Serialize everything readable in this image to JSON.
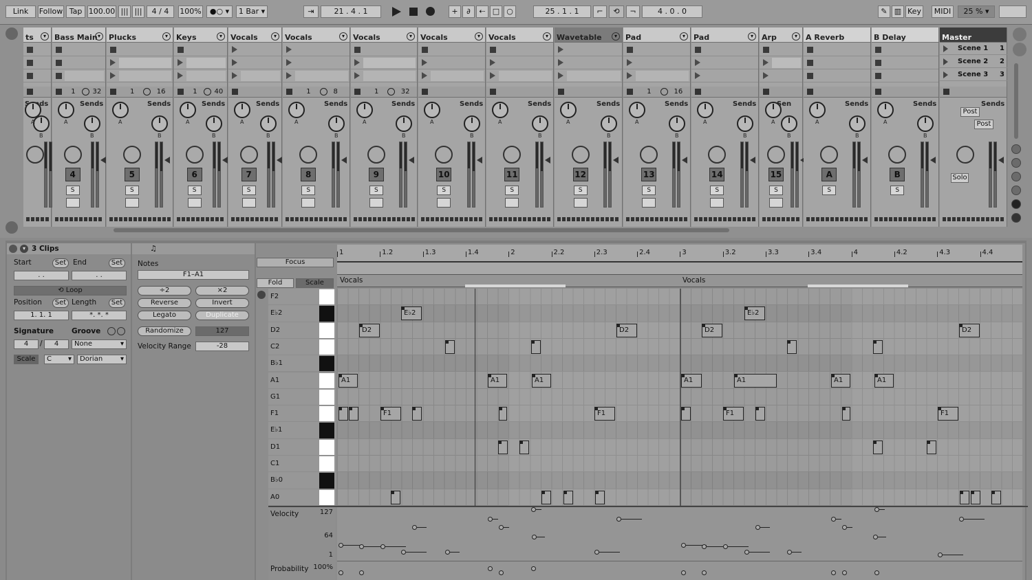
{
  "transport": {
    "link": "Link",
    "follow": "Follow",
    "tap": "Tap",
    "tempo": "100.00",
    "signature": "4 / 4",
    "zoom": "100%",
    "quantize": "1 Bar",
    "arrangement_pos": "21 .  4 .  1",
    "loop_start": "25 .  1 .  1",
    "loop_length": "4 .  0 .  0",
    "key": "Key",
    "midi": "MIDI",
    "cpu": "25 %"
  },
  "tracks": [
    {
      "name": "ts",
      "num": ""
    },
    {
      "name": "Bass Main",
      "num": "4",
      "in1": "1",
      "in2": "32"
    },
    {
      "name": "Plucks",
      "num": "5",
      "in1": "1",
      "in2": "16"
    },
    {
      "name": "Keys",
      "num": "6",
      "in1": "1",
      "in2": "40"
    },
    {
      "name": "Vocals",
      "num": "7"
    },
    {
      "name": "Vocals",
      "num": "8",
      "in1": "1",
      "in2": "8"
    },
    {
      "name": "Vocals",
      "num": "9",
      "in1": "1",
      "in2": "32"
    },
    {
      "name": "Vocals",
      "num": "10"
    },
    {
      "name": "Vocals",
      "num": "11"
    },
    {
      "name": "Wavetable",
      "num": "12"
    },
    {
      "name": "Pad",
      "num": "13",
      "in1": "1",
      "in2": "16"
    },
    {
      "name": "Pad",
      "num": "14"
    },
    {
      "name": "Arp",
      "num": "15"
    },
    {
      "name": "A Reverb",
      "num": "A"
    },
    {
      "name": "B Delay",
      "num": "B"
    },
    {
      "name": "Master",
      "num": ""
    }
  ],
  "labels": {
    "sends": "Sends",
    "a": "A",
    "b": "B",
    "s": "S",
    "solo": "Solo",
    "post": "Post",
    "send_trunc": "Sen"
  },
  "scenes": [
    {
      "name": "Scene 1",
      "num": "1"
    },
    {
      "name": "Scene 2",
      "num": "2"
    },
    {
      "name": "Scene 3",
      "num": "3"
    }
  ],
  "clip_panel": {
    "title": "3 Clips",
    "start": "Start",
    "end": "End",
    "set": "Set",
    "loop": "Loop",
    "position": "Position",
    "length": "Length",
    "position_value": "1.   1.   1",
    "length_value": "*.   *.   *",
    "start_value": ".      .",
    "end_value": ".      .",
    "signature": "Signature",
    "groove": "Groove",
    "sig_num": "4",
    "sig_den": "4",
    "groove_value": "None",
    "scale": "Scale",
    "scale_root": "C",
    "scale_mode": "Dorian"
  },
  "notes_panel": {
    "notes": "Notes",
    "range": "F1–A1",
    "div2": "÷2",
    "mul2": "×2",
    "reverse": "Reverse",
    "invert": "Invert",
    "legato": "Legato",
    "duplicate": "Duplicate",
    "randomize": "Randomize",
    "randomize_value": "127",
    "velocity_range": "Velocity Range",
    "velocity_range_value": "-28"
  },
  "editor": {
    "focus": "Focus",
    "fold": "Fold",
    "scale": "Scale",
    "ruler": [
      "1",
      "1.2",
      "1.3",
      "1.4",
      "2",
      "2.2",
      "2.3",
      "2.4",
      "3",
      "3.2",
      "3.3",
      "3.4",
      "4",
      "4.2",
      "4.3",
      "4.4"
    ],
    "clip_names": [
      "Vocals",
      "Vocals"
    ],
    "keys": [
      {
        "name": "F2",
        "black": false
      },
      {
        "name": "E♭2",
        "black": true
      },
      {
        "name": "D2",
        "black": false
      },
      {
        "name": "C2",
        "black": false
      },
      {
        "name": "B♭1",
        "black": true
      },
      {
        "name": "A1",
        "black": false
      },
      {
        "name": "G1",
        "black": false
      },
      {
        "name": "F1",
        "black": false
      },
      {
        "name": "E♭1",
        "black": true
      },
      {
        "name": "D1",
        "black": false
      },
      {
        "name": "C1",
        "black": false
      },
      {
        "name": "B♭0",
        "black": true
      },
      {
        "name": "A0",
        "black": false
      }
    ],
    "velocity": "Velocity",
    "vel_max": "127",
    "vel_mid": "64",
    "vel_min": "1",
    "probability": "Probability",
    "prob_max": "100%"
  }
}
